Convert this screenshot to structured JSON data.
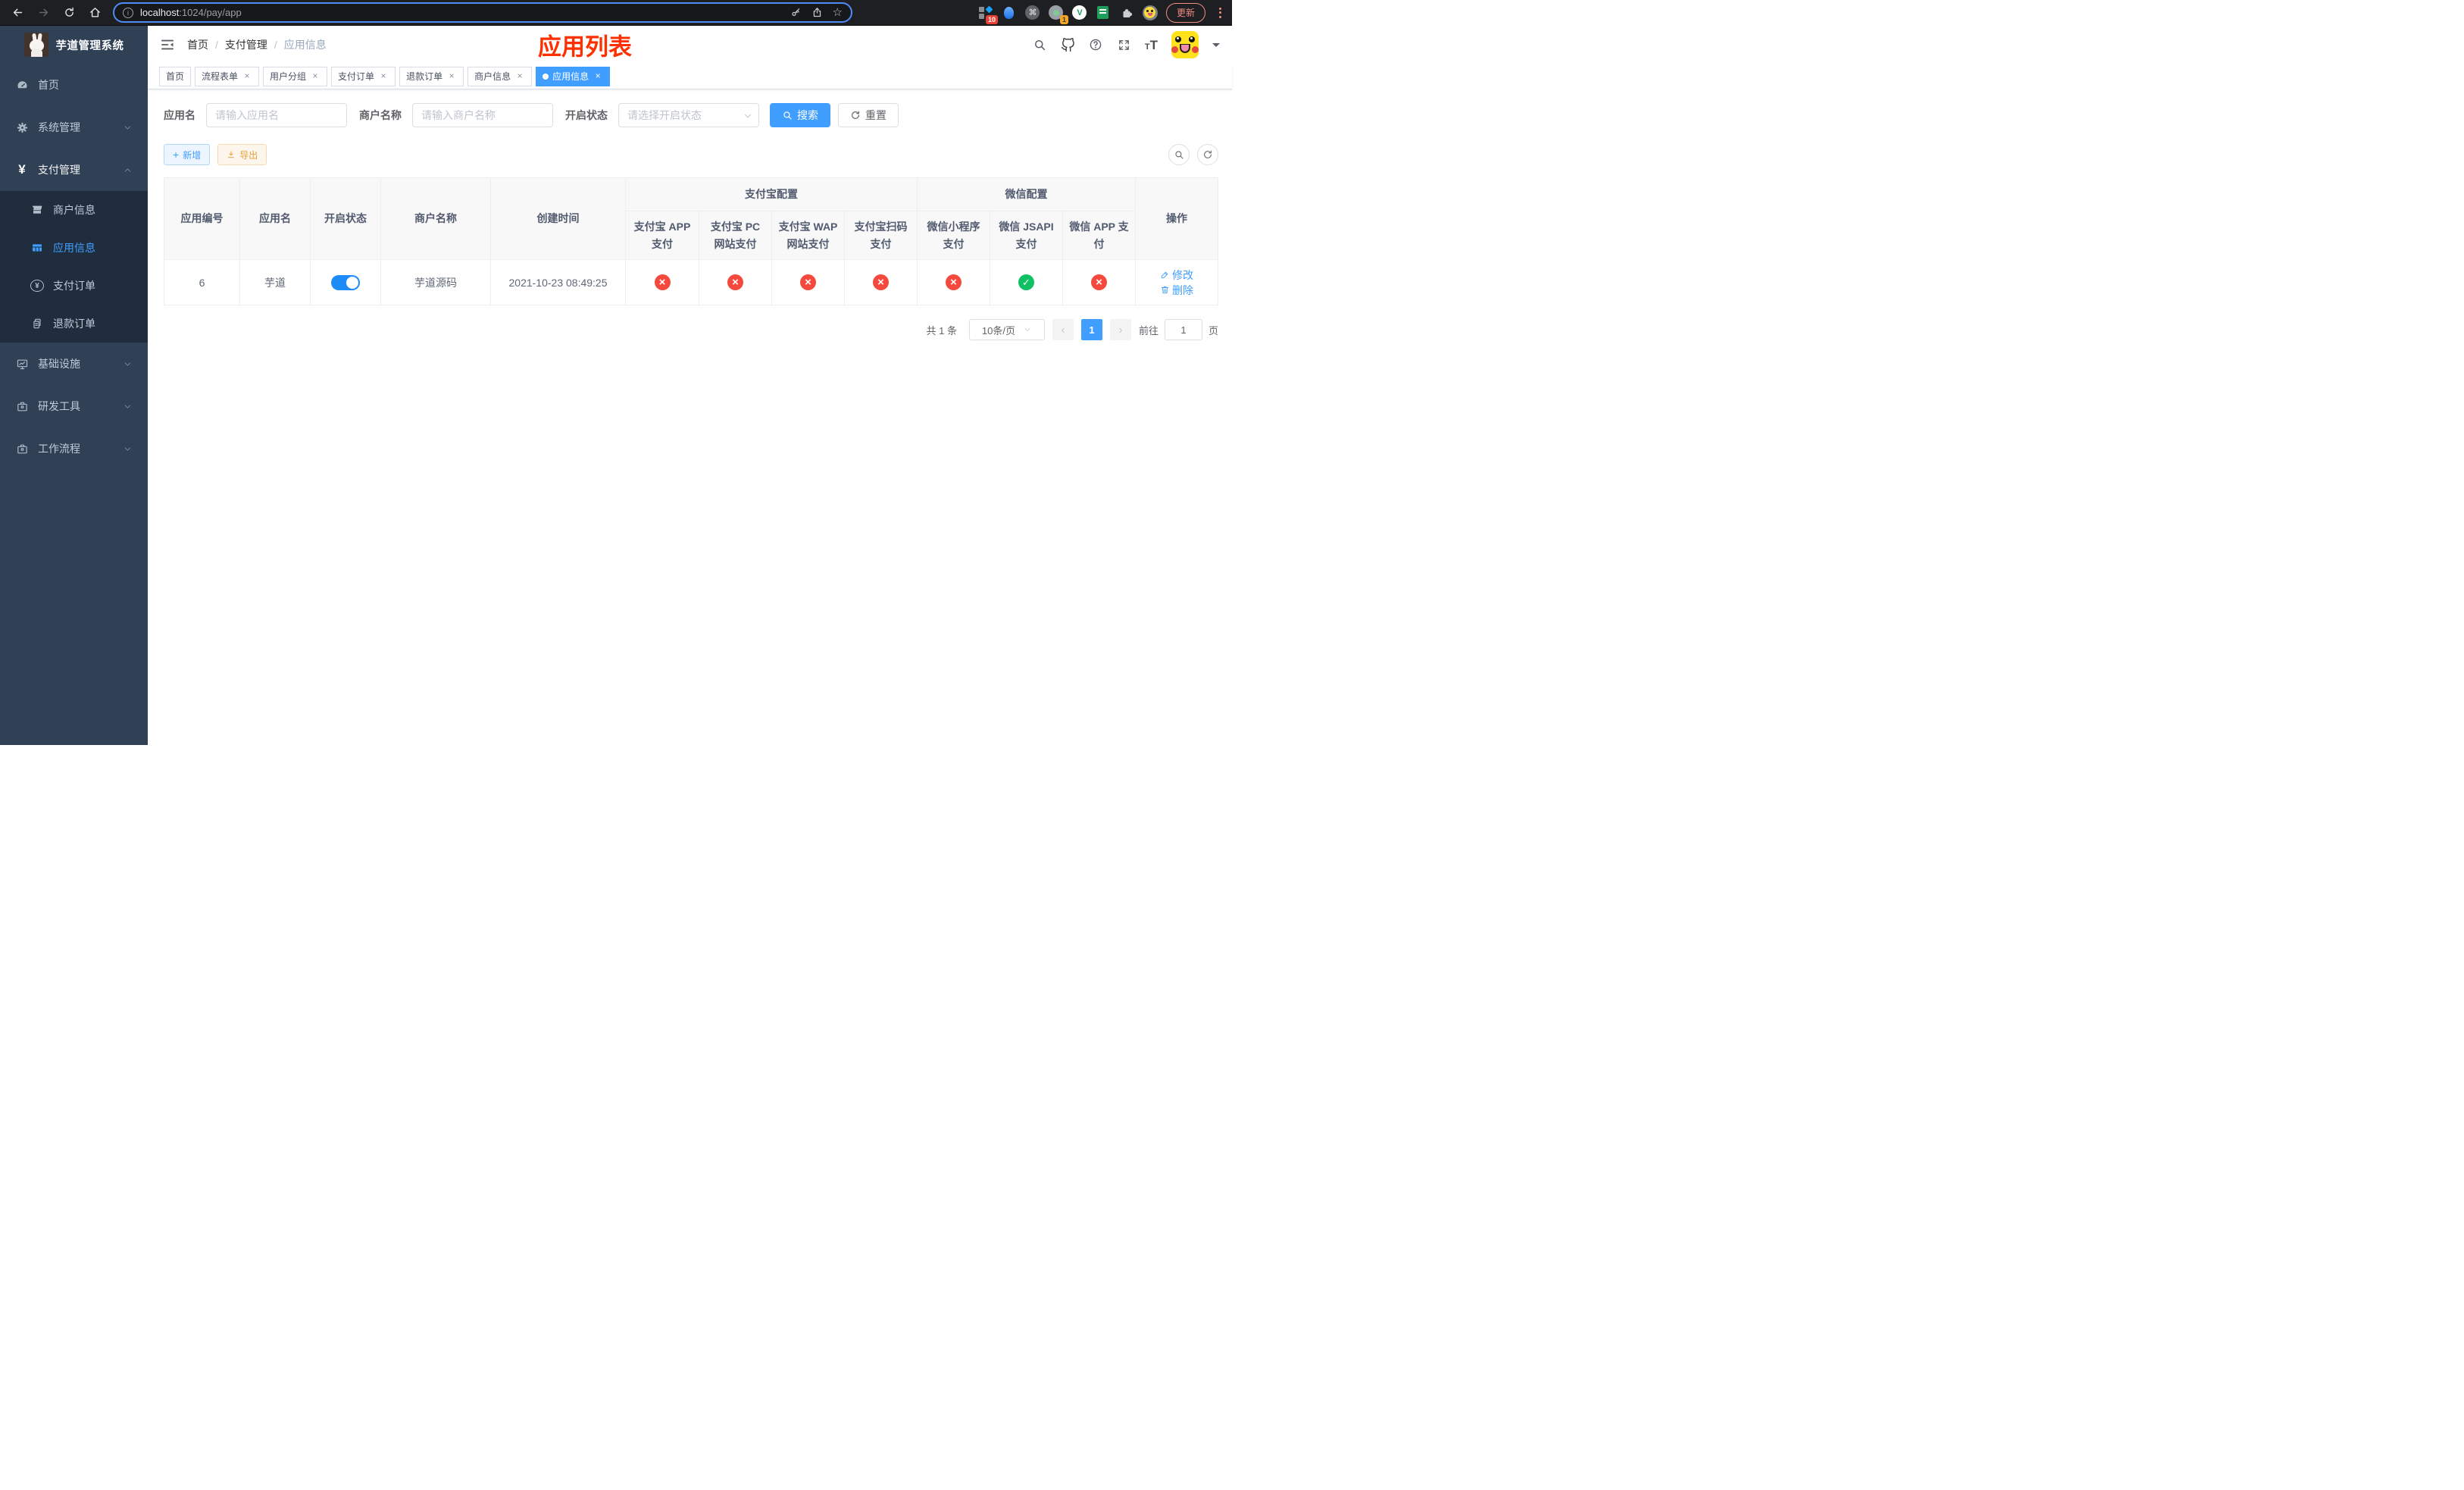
{
  "colors": {
    "accent": "#409eff",
    "danger": "#f5493d",
    "success": "#10c064",
    "title_red": "#ff3000"
  },
  "browser": {
    "url_host": "localhost",
    "url_rest": ":1024/pay/app",
    "update_label": "更新",
    "badge_ext1": "10",
    "badge_ext2": "1"
  },
  "sidebar": {
    "title": "芋道管理系统",
    "items": [
      {
        "label": "首页",
        "icon": "dashboard-icon"
      },
      {
        "label": "系统管理",
        "icon": "gear-icon"
      },
      {
        "label": "支付管理",
        "icon": "yen-icon",
        "expanded": true
      },
      {
        "label": "基础设施",
        "icon": "monitor-icon"
      },
      {
        "label": "研发工具",
        "icon": "toolbox-icon"
      },
      {
        "label": "工作流程",
        "icon": "toolbox-icon"
      }
    ],
    "submenu": [
      {
        "label": "商户信息",
        "icon": "shop-icon"
      },
      {
        "label": "应用信息",
        "icon": "grid-icon",
        "active": true
      },
      {
        "label": "支付订单",
        "icon": "yen-circle-icon"
      },
      {
        "label": "退款订单",
        "icon": "document-icon"
      }
    ]
  },
  "header": {
    "breadcrumb": [
      {
        "label": "首页"
      },
      {
        "label": "支付管理"
      },
      {
        "label": "应用信息"
      }
    ],
    "overlay_title": "应用列表"
  },
  "tabs": [
    {
      "label": "首页",
      "closable": false,
      "active": false
    },
    {
      "label": "流程表单",
      "closable": true,
      "active": false
    },
    {
      "label": "用户分组",
      "closable": true,
      "active": false
    },
    {
      "label": "支付订单",
      "closable": true,
      "active": false
    },
    {
      "label": "退款订单",
      "closable": true,
      "active": false
    },
    {
      "label": "商户信息",
      "closable": true,
      "active": false
    },
    {
      "label": "应用信息",
      "closable": true,
      "active": true
    }
  ],
  "filters": {
    "app_name_label": "应用名",
    "app_name_placeholder": "请输入应用名",
    "merchant_label": "商户名称",
    "merchant_placeholder": "请输入商户名称",
    "status_label": "开启状态",
    "status_placeholder": "请选择开启状态",
    "search_label": "搜索",
    "reset_label": "重置"
  },
  "toolbar": {
    "add_label": "新增",
    "export_label": "导出"
  },
  "table": {
    "group_headers": {
      "alipay": "支付宝配置",
      "wechat": "微信配置"
    },
    "columns": [
      "应用编号",
      "应用名",
      "开启状态",
      "商户名称",
      "创建时间",
      "支付宝 APP 支付",
      "支付宝 PC 网站支付",
      "支付宝 WAP 网站支付",
      "支付宝扫码支付",
      "微信小程序支付",
      "微信 JSAPI 支付",
      "微信 APP 支付",
      "操作"
    ],
    "rows": [
      {
        "id": "6",
        "name": "芋道",
        "enabled": true,
        "merchant": "芋道源码",
        "created": "2021-10-23 08:49:25",
        "channels": [
          false,
          false,
          false,
          false,
          false,
          true,
          false
        ],
        "actions": {
          "edit": "修改",
          "delete": "删除"
        }
      }
    ]
  },
  "pagination": {
    "total": "共 1 条",
    "page_size": "10条/页",
    "current_page": "1",
    "jump_prefix": "前往",
    "jump_value": "1",
    "jump_suffix": "页"
  }
}
